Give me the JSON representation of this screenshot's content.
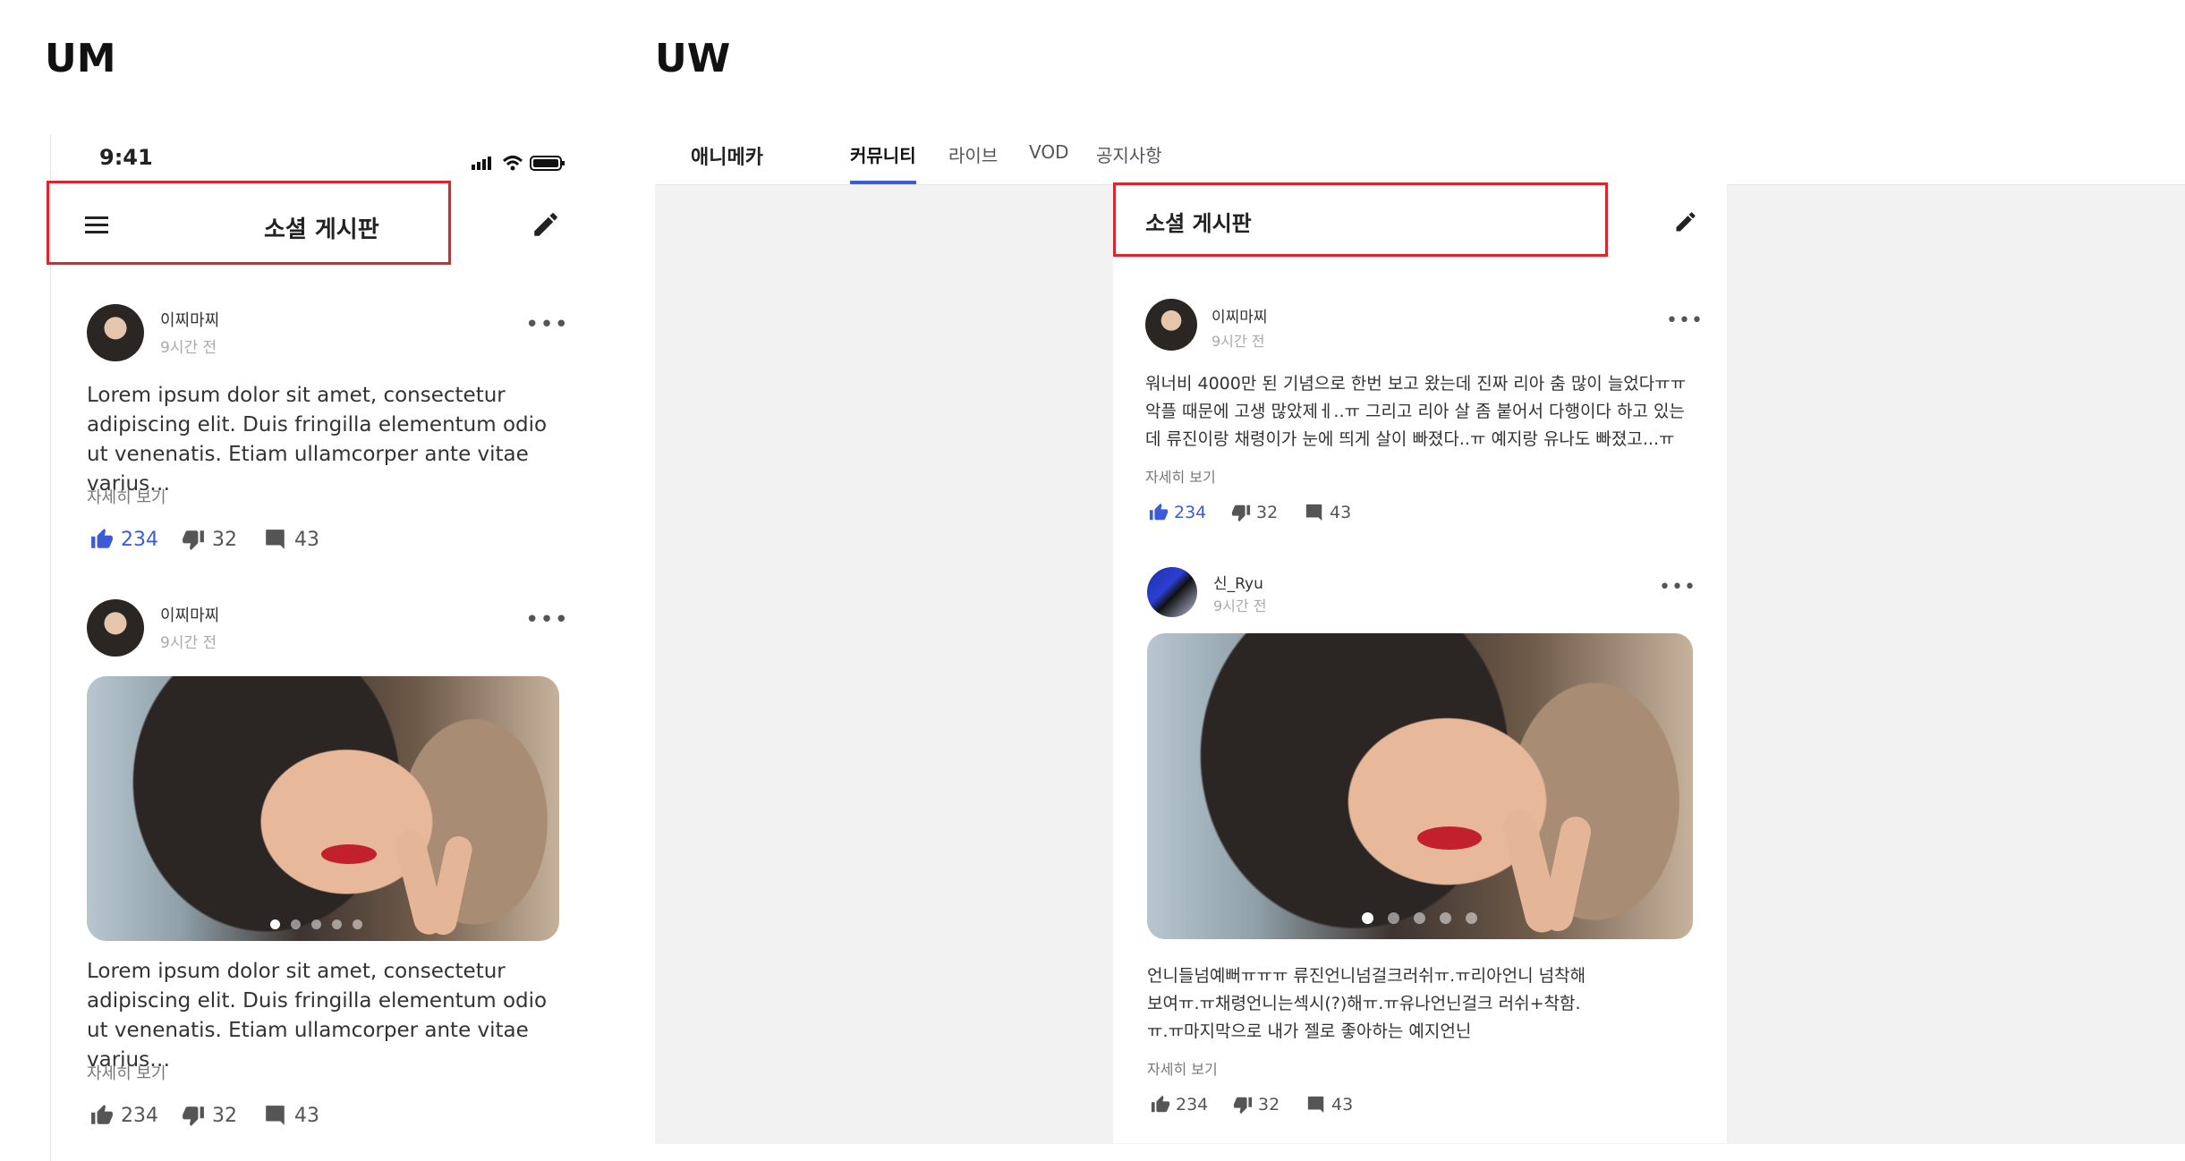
{
  "labels": {
    "mobile": "UM",
    "web": "UW"
  },
  "mobile": {
    "status_time": "9:41",
    "title": "소셜 게시판",
    "posts": [
      {
        "author": "이찌마찌",
        "time": "9시간 전",
        "body": "Lorem ipsum dolor sit amet, consectetur adipiscing elit. Duis fringilla elementum odio ut venenatis. Etiam ullamcorper ante vitae varius…",
        "more": "자세히 보기",
        "likes": "234",
        "dislikes": "32",
        "comments": "43"
      },
      {
        "author": "이찌마찌",
        "time": "9시간 전",
        "body": "Lorem ipsum dolor sit amet, consectetur adipiscing elit. Duis fringilla elementum odio ut venenatis. Etiam ullamcorper ante vitae varius…",
        "more": "자세히 보기",
        "likes": "234",
        "dislikes": "32",
        "comments": "43"
      }
    ]
  },
  "web": {
    "brand": "애니메카",
    "tabs": [
      "커뮤니티",
      "라이브",
      "VOD",
      "공지사항"
    ],
    "title": "소셜 게시판",
    "posts": [
      {
        "author": "이찌마찌",
        "time": "9시간 전",
        "body": "워너비 4000만 된 기념으로 한번 보고 왔는데 진짜 리아 춤 많이 늘었다ㅠㅠ 악플 때문에 고생 많았제ㅔ..ㅠ 그리고 리아 살 좀 붙어서 다행이다 하고 있는데 류진이랑 채령이가 눈에 띄게 살이 빠졌다..ㅠ 예지랑 유나도 빠졌고...ㅠ",
        "more": "자세히 보기",
        "likes": "234",
        "dislikes": "32",
        "comments": "43"
      },
      {
        "author": "신_Ryu",
        "time": "9시간 전",
        "body": "언니들넘예뻐ㅠㅠㅠ 류진언니넘걸크러쉬ㅠ.ㅠ리아언니 넘착해보여ㅠ.ㅠ채령언니는섹시(?)해ㅠ.ㅠ유나언닌걸크 러쉬+착함.ㅠ.ㅠ마지막으로 내가 젤로 좋아하는 예지언닌",
        "more": "자세히 보기",
        "likes": "234",
        "dislikes": "32",
        "comments": "43"
      }
    ]
  },
  "colors": {
    "accent": "#3b5bdb",
    "highlight": "#e0242b",
    "background_gray": "#f2f2f2"
  },
  "icons": [
    "menu-icon",
    "pencil-icon",
    "thumbs-up-icon",
    "thumbs-down-icon",
    "comment-icon",
    "more-icon",
    "signal-icon",
    "wifi-icon",
    "battery-icon"
  ]
}
